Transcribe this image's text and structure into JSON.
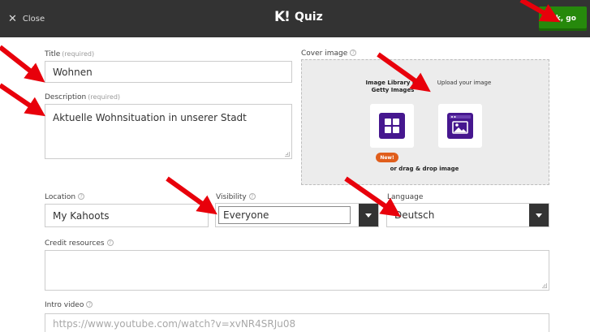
{
  "header": {
    "close_label": "Close",
    "brand_logo": "K!",
    "brand_title": "Quiz",
    "ok_label": "Ok, go"
  },
  "form": {
    "title": {
      "label": "Title",
      "required": "(required)",
      "value": "Wohnen"
    },
    "description": {
      "label": "Description",
      "required": "(required)",
      "value": "Aktuelle Wohnsituation in unserer Stadt"
    },
    "cover": {
      "label": "Cover image",
      "library_label": "Image Library by Getty Images",
      "upload_label": "Upload your image",
      "new_badge": "New!",
      "drag_label": "or drag & drop image"
    },
    "location": {
      "label": "Location",
      "value": "My Kahoots"
    },
    "visibility": {
      "label": "Visibility",
      "value": "Everyone"
    },
    "language": {
      "label": "Language",
      "value": "Deutsch"
    },
    "credit": {
      "label": "Credit resources",
      "value": ""
    },
    "intro_video": {
      "label": "Intro video",
      "placeholder": "https://www.youtube.com/watch?v=xvNR4SRJu08"
    }
  },
  "colors": {
    "header_bg": "#333333",
    "ok_button": "#26890c",
    "library_icon": "#46178f",
    "new_badge": "#e05e1c",
    "annotation_arrow": "#e8000b"
  },
  "icons": [
    "close-icon",
    "help-icon",
    "image-library-icon",
    "upload-image-icon",
    "chevron-down-icon",
    "annotation-arrow-icon"
  ]
}
